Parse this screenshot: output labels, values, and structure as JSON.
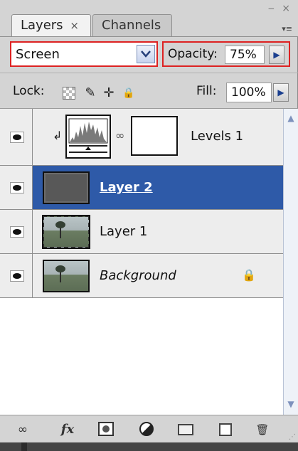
{
  "tabs": {
    "layers_label": "Layers",
    "layers_close": "×",
    "channels_label": "Channels",
    "minimize": "‒",
    "close": "×",
    "menu": "▾≡"
  },
  "blend": {
    "mode": "Screen",
    "dropdown": "❯"
  },
  "opacity": {
    "label": "Opacity:",
    "value": "75%",
    "arrow": "▶"
  },
  "lock": {
    "label": "Lock:",
    "brush": "✎",
    "move": "✛",
    "lock": "🔒"
  },
  "fill": {
    "label": "Fill:",
    "value": "100%",
    "arrow": "▶"
  },
  "layers": [
    {
      "name": "Levels 1",
      "type": "adjustment",
      "visible": true,
      "selected": false,
      "clip": "↲",
      "link": "∞"
    },
    {
      "name": "Layer 2",
      "type": "pixel",
      "visible": true,
      "selected": true
    },
    {
      "name": "Layer 1",
      "type": "pixel",
      "visible": true,
      "selected": false
    },
    {
      "name": "Background",
      "type": "pixel",
      "visible": true,
      "selected": false,
      "locked": true,
      "lock_glyph": "🔒"
    }
  ],
  "scrollbar": {
    "up": "▲",
    "down": "▼"
  },
  "toolbar": {
    "link": "∞",
    "fx": "fx",
    "trash": "🗑",
    "grip": "⋰"
  },
  "colors": {
    "selection": "#2e5aa8",
    "highlight_box": "#dd2222",
    "panel": "#d4d4d4"
  }
}
